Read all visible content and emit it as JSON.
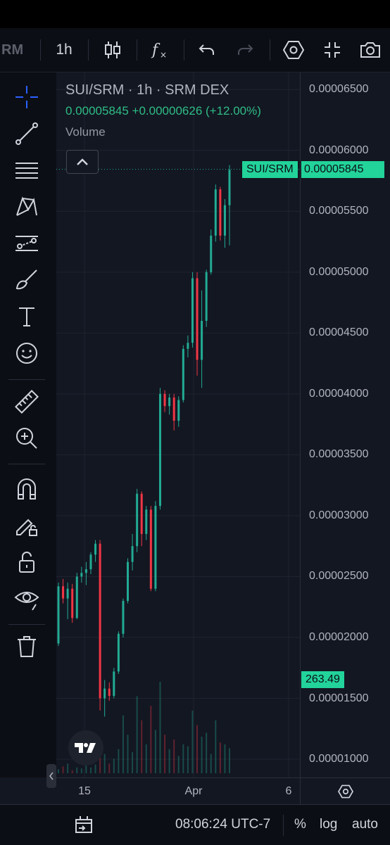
{
  "toolbar": {
    "symbol_partial": "RM",
    "interval": "1h"
  },
  "legend": {
    "title": "SUI/SRM · 1h · SRM DEX",
    "price_change": "0.00005845  +0.00000626 (+12.00%)",
    "volume_label": "Volume"
  },
  "price_scale": {
    "labels": [
      "0.00006500",
      "0.00006000",
      "0.00005500",
      "0.00005000",
      "0.00004500",
      "0.00004000",
      "0.00003500",
      "0.00003000",
      "0.00002500",
      "0.00002000",
      "0.00001500",
      "0.00001000"
    ],
    "current_tag_symbol": "SUI/SRM",
    "current_tag_value": "0.00005845",
    "volume_tag": "263.49"
  },
  "time_scale": {
    "labels": [
      "15",
      "Apr",
      "6"
    ]
  },
  "bottom_bar": {
    "clock": "08:06:24 UTC-7",
    "percent": "%",
    "log": "log",
    "auto": "auto"
  },
  "colors": {
    "up": "#22ab94",
    "down": "#f23645",
    "accent": "#2962ff",
    "tag": "#22d39a"
  },
  "chart_data": {
    "type": "candlestick",
    "title": "SUI/SRM · 1h · SRM DEX",
    "x_labels": [
      "15",
      "Apr",
      "6"
    ],
    "ylim": [
      8.5e-06,
      6.64e-05
    ],
    "last_price": 5.845e-05,
    "change": 6.26e-06,
    "change_pct": 12.0,
    "last_volume": 263.49,
    "candles": [
      {
        "o": 1.95e-05,
        "h": 2.45e-05,
        "l": 1.93e-05,
        "c": 2.42e-05
      },
      {
        "o": 2.42e-05,
        "h": 2.48e-05,
        "l": 2.28e-05,
        "c": 2.32e-05
      },
      {
        "o": 2.32e-05,
        "h": 2.45e-05,
        "l": 2.15e-05,
        "c": 2.4e-05
      },
      {
        "o": 2.4e-05,
        "h": 2.44e-05,
        "l": 2.12e-05,
        "c": 2.16e-05
      },
      {
        "o": 2.16e-05,
        "h": 2.53e-05,
        "l": 2.15e-05,
        "c": 2.5e-05
      },
      {
        "o": 2.5e-05,
        "h": 2.58e-05,
        "l": 2.45e-05,
        "c": 2.53e-05
      },
      {
        "o": 2.53e-05,
        "h": 2.62e-05,
        "l": 2.43e-05,
        "c": 2.56e-05
      },
      {
        "o": 2.56e-05,
        "h": 2.7e-05,
        "l": 2.52e-05,
        "c": 2.68e-05
      },
      {
        "o": 2.68e-05,
        "h": 2.8e-05,
        "l": 2.62e-05,
        "c": 2.77e-05
      },
      {
        "o": 2.77e-05,
        "h": 2.8e-05,
        "l": 1.4e-05,
        "c": 1.5e-05
      },
      {
        "o": 1.5e-05,
        "h": 1.65e-05,
        "l": 1.35e-05,
        "c": 1.58e-05
      },
      {
        "o": 1.58e-05,
        "h": 1.63e-05,
        "l": 1.48e-05,
        "c": 1.52e-05
      },
      {
        "o": 1.52e-05,
        "h": 1.75e-05,
        "l": 1.5e-05,
        "c": 1.72e-05
      },
      {
        "o": 1.72e-05,
        "h": 2.05e-05,
        "l": 1.7e-05,
        "c": 2.03e-05
      },
      {
        "o": 2.03e-05,
        "h": 2.32e-05,
        "l": 2e-05,
        "c": 2.3e-05
      },
      {
        "o": 2.3e-05,
        "h": 2.65e-05,
        "l": 2.28e-05,
        "c": 2.62e-05
      },
      {
        "o": 2.62e-05,
        "h": 2.85e-05,
        "l": 2.55e-05,
        "c": 2.75e-05
      },
      {
        "o": 2.75e-05,
        "h": 3.22e-05,
        "l": 2.7e-05,
        "c": 3.18e-05
      },
      {
        "o": 3.18e-05,
        "h": 3.2e-05,
        "l": 2.75e-05,
        "c": 2.85e-05
      },
      {
        "o": 2.85e-05,
        "h": 3.08e-05,
        "l": 2.8e-05,
        "c": 3.05e-05
      },
      {
        "o": 3.05e-05,
        "h": 3.08e-05,
        "l": 2.38e-05,
        "c": 2.4e-05
      },
      {
        "o": 2.4e-05,
        "h": 3.12e-05,
        "l": 2.38e-05,
        "c": 3.08e-05
      },
      {
        "o": 3.08e-05,
        "h": 4.05e-05,
        "l": 3.05e-05,
        "c": 4e-05
      },
      {
        "o": 4e-05,
        "h": 4.03e-05,
        "l": 3.85e-05,
        "c": 3.9e-05
      },
      {
        "o": 3.9e-05,
        "h": 4e-05,
        "l": 3.83e-05,
        "c": 3.97e-05
      },
      {
        "o": 3.97e-05,
        "h": 4e-05,
        "l": 3.7e-05,
        "c": 3.78e-05
      },
      {
        "o": 3.78e-05,
        "h": 3.98e-05,
        "l": 3.73e-05,
        "c": 3.95e-05
      },
      {
        "o": 3.95e-05,
        "h": 4.4e-05,
        "l": 3.93e-05,
        "c": 4.37e-05
      },
      {
        "o": 4.37e-05,
        "h": 4.48e-05,
        "l": 4.3e-05,
        "c": 4.42e-05
      },
      {
        "o": 4.42e-05,
        "h": 5e-05,
        "l": 4.38e-05,
        "c": 4.95e-05
      },
      {
        "o": 4.95e-05,
        "h": 5e-05,
        "l": 4.15e-05,
        "c": 4.28e-05
      },
      {
        "o": 4.28e-05,
        "h": 4.85e-05,
        "l": 4.05e-05,
        "c": 4.6e-05
      },
      {
        "o": 4.6e-05,
        "h": 5.02e-05,
        "l": 4.55e-05,
        "c": 5e-05
      },
      {
        "o": 5e-05,
        "h": 5.35e-05,
        "l": 4.98e-05,
        "c": 5.3e-05
      },
      {
        "o": 5.3e-05,
        "h": 5.72e-05,
        "l": 5.25e-05,
        "c": 5.68e-05
      },
      {
        "o": 5.68e-05,
        "h": 5.7e-05,
        "l": 5.26e-05,
        "c": 5.3e-05
      },
      {
        "o": 5.3e-05,
        "h": 5.6e-05,
        "l": 5.2e-05,
        "c": 5.55e-05
      },
      {
        "o": 5.55e-05,
        "h": 5.88e-05,
        "l": 5.22e-05,
        "c": 5.84e-05
      }
    ],
    "volumes": [
      4,
      7,
      10,
      3,
      6,
      5,
      8,
      6,
      9,
      35,
      20,
      10,
      15,
      25,
      60,
      40,
      22,
      80,
      55,
      30,
      70,
      45,
      95,
      40,
      25,
      35,
      18,
      30,
      28,
      65,
      50,
      38,
      42,
      20,
      55,
      32,
      30,
      26
    ]
  }
}
